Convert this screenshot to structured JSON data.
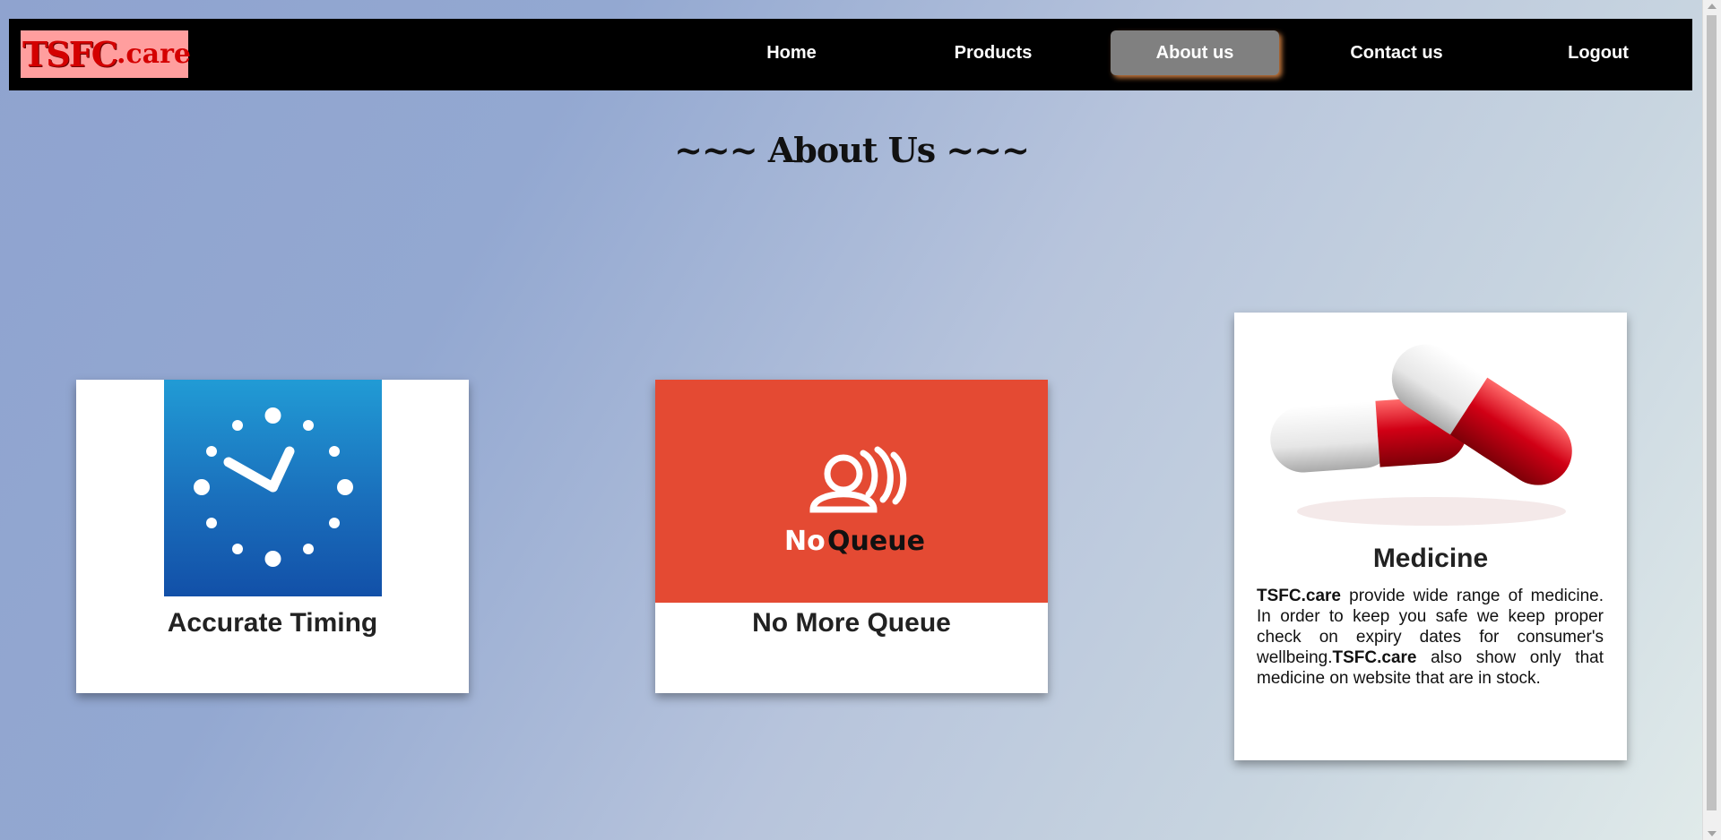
{
  "navbar": {
    "logo": {
      "brand": "TSFC",
      "tld": ".care"
    },
    "items": [
      {
        "label": "Home",
        "active": false
      },
      {
        "label": "Products",
        "active": false
      },
      {
        "label": "About us",
        "active": true
      },
      {
        "label": "Contact us",
        "active": false
      },
      {
        "label": "Logout",
        "active": false
      }
    ]
  },
  "page": {
    "title": "~~~ About Us ~~~"
  },
  "cards": [
    {
      "title": "Accurate Timing",
      "image": "clock-icon"
    },
    {
      "title": "No More Queue",
      "image": "no-queue-logo",
      "logo_text_1": "No",
      "logo_text_2": "Queue"
    },
    {
      "title": "Medicine",
      "image": "pills-image",
      "text": {
        "brand1": "TSFC.care",
        "part1": " provide wide range of medicine. In order to keep you safe we keep proper check on expiry dates for consumer's wellbeing.",
        "brand2": "TSFC.care",
        "part2": " also show only that medicine on website that are in stock."
      }
    }
  ],
  "colors": {
    "navbar": "#000000",
    "active_nav": "#808080",
    "logo_bg": "#ff9e9e",
    "logo_text": "#d40000",
    "queue_bg": "#e44a33",
    "clock_top": "#219bd5",
    "clock_bottom": "#1250a8"
  }
}
